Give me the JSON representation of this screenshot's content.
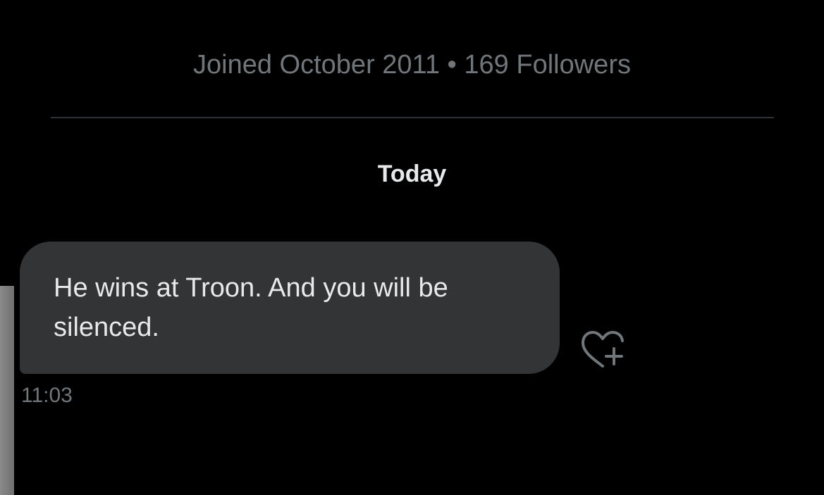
{
  "profile": {
    "meta": "Joined October 2011 • 169 Followers"
  },
  "conversation": {
    "date_separator": "Today",
    "messages": [
      {
        "text": "He wins at Troon. And you will be silenced.",
        "time": "11:03",
        "reaction_icon": "heart-plus-icon"
      }
    ]
  },
  "colors": {
    "background": "#000000",
    "bubble": "#333436",
    "primary_text": "#e7e9ea",
    "secondary_text": "#71767b",
    "divider": "#2f3336"
  }
}
